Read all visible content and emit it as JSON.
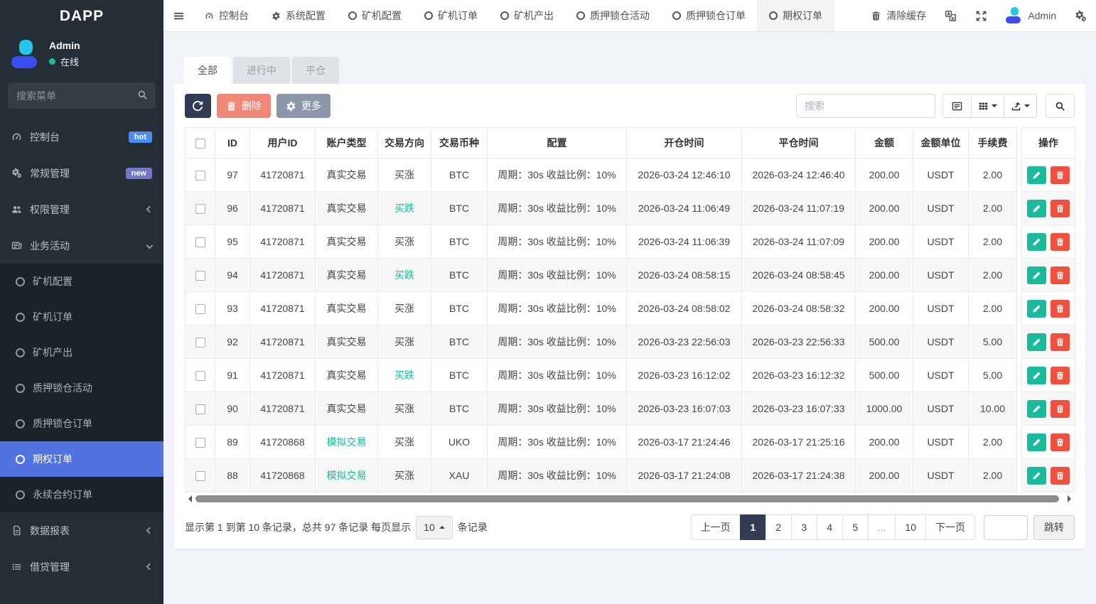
{
  "app": {
    "brand": "DAPP"
  },
  "colors": {
    "accent_green": "#18bc9c",
    "danger_red": "#f2503f",
    "navy": "#313c53",
    "active_blue": "#5172e0",
    "hot_badge": "#4a8cf5",
    "new_badge": "#7277c9"
  },
  "sidebar": {
    "user": {
      "name": "Admin",
      "status": "在线"
    },
    "search_placeholder": "搜索菜单",
    "items": [
      {
        "label": "控制台",
        "icon": "dashboard-icon",
        "badge": "hot",
        "badge_color": "#4a8cf5"
      },
      {
        "label": "常规管理",
        "icon": "gears-icon",
        "badge": "new",
        "badge_color": "#7277c9"
      },
      {
        "label": "权限管理",
        "icon": "users-icon",
        "chevron": "left"
      },
      {
        "label": "业务活动",
        "icon": "newspaper-icon",
        "chevron": "down",
        "children": [
          {
            "label": "矿机配置"
          },
          {
            "label": "矿机订单"
          },
          {
            "label": "矿机产出"
          },
          {
            "label": "质押锁仓活动"
          },
          {
            "label": "质押锁仓订单"
          },
          {
            "label": "期权订单",
            "active": true
          },
          {
            "label": "永续合约订单"
          }
        ]
      },
      {
        "label": "数据报表",
        "icon": "file-icon",
        "chevron": "left"
      },
      {
        "label": "借贷管理",
        "icon": "list-icon",
        "chevron": "left"
      }
    ]
  },
  "topbar": {
    "tabs": [
      {
        "label": "控制台",
        "icon": "dashboard-icon"
      },
      {
        "label": "系统配置",
        "icon": "gear-icon"
      },
      {
        "label": "矿机配置",
        "icon": "circle-icon"
      },
      {
        "label": "矿机订单",
        "icon": "circle-icon"
      },
      {
        "label": "矿机产出",
        "icon": "circle-icon"
      },
      {
        "label": "质押锁仓活动",
        "icon": "circle-icon"
      },
      {
        "label": "质押锁仓订单",
        "icon": "circle-icon"
      },
      {
        "label": "期权订单",
        "icon": "circle-icon",
        "active": true
      }
    ],
    "clear_cache": "清除缓存",
    "user": "Admin"
  },
  "page": {
    "tabs": [
      {
        "label": "全部",
        "active": true
      },
      {
        "label": "进行中"
      },
      {
        "label": "平仓"
      }
    ],
    "toolbar": {
      "delete_label": "删除",
      "more_label": "更多",
      "search_placeholder": "搜索"
    },
    "table": {
      "columns": [
        "ID",
        "用户ID",
        "账户类型",
        "交易方向",
        "交易币种",
        "配置",
        "开仓时间",
        "平仓时间",
        "金额",
        "金额单位",
        "手续费",
        "操作"
      ],
      "rows": [
        {
          "id": "97",
          "uid": "41720871",
          "account": "真实交易",
          "account_style": "real",
          "direction": "买涨",
          "direction_style": "up",
          "coin": "BTC",
          "config": "周期：30s 收益比例：10%",
          "open_time": "2026-03-24 12:46:10",
          "close_time": "2026-03-24 12:46:40",
          "amount": "200.00",
          "unit": "USDT",
          "fee": "2.00"
        },
        {
          "id": "96",
          "uid": "41720871",
          "account": "真实交易",
          "account_style": "real",
          "direction": "买跌",
          "direction_style": "down",
          "coin": "BTC",
          "config": "周期：30s 收益比例：10%",
          "open_time": "2026-03-24 11:06:49",
          "close_time": "2026-03-24 11:07:19",
          "amount": "200.00",
          "unit": "USDT",
          "fee": "2.00"
        },
        {
          "id": "95",
          "uid": "41720871",
          "account": "真实交易",
          "account_style": "real",
          "direction": "买涨",
          "direction_style": "up",
          "coin": "BTC",
          "config": "周期：30s 收益比例：10%",
          "open_time": "2026-03-24 11:06:39",
          "close_time": "2026-03-24 11:07:09",
          "amount": "200.00",
          "unit": "USDT",
          "fee": "2.00"
        },
        {
          "id": "94",
          "uid": "41720871",
          "account": "真实交易",
          "account_style": "real",
          "direction": "买跌",
          "direction_style": "down",
          "coin": "BTC",
          "config": "周期：30s 收益比例：10%",
          "open_time": "2026-03-24 08:58:15",
          "close_time": "2026-03-24 08:58:45",
          "amount": "200.00",
          "unit": "USDT",
          "fee": "2.00"
        },
        {
          "id": "93",
          "uid": "41720871",
          "account": "真实交易",
          "account_style": "real",
          "direction": "买涨",
          "direction_style": "up",
          "coin": "BTC",
          "config": "周期：30s 收益比例：10%",
          "open_time": "2026-03-24 08:58:02",
          "close_time": "2026-03-24 08:58:32",
          "amount": "200.00",
          "unit": "USDT",
          "fee": "2.00"
        },
        {
          "id": "92",
          "uid": "41720871",
          "account": "真实交易",
          "account_style": "real",
          "direction": "买涨",
          "direction_style": "up",
          "coin": "BTC",
          "config": "周期：30s 收益比例：10%",
          "open_time": "2026-03-23 22:56:03",
          "close_time": "2026-03-23 22:56:33",
          "amount": "500.00",
          "unit": "USDT",
          "fee": "5.00"
        },
        {
          "id": "91",
          "uid": "41720871",
          "account": "真实交易",
          "account_style": "real",
          "direction": "买跌",
          "direction_style": "down",
          "coin": "BTC",
          "config": "周期：30s 收益比例：10%",
          "open_time": "2026-03-23 16:12:02",
          "close_time": "2026-03-23 16:12:32",
          "amount": "500.00",
          "unit": "USDT",
          "fee": "5.00"
        },
        {
          "id": "90",
          "uid": "41720871",
          "account": "真实交易",
          "account_style": "real",
          "direction": "买涨",
          "direction_style": "up",
          "coin": "BTC",
          "config": "周期：30s 收益比例：10%",
          "open_time": "2026-03-23 16:07:03",
          "close_time": "2026-03-23 16:07:33",
          "amount": "1000.00",
          "unit": "USDT",
          "fee": "10.00"
        },
        {
          "id": "89",
          "uid": "41720868",
          "account": "模拟交易",
          "account_style": "sim",
          "direction": "买涨",
          "direction_style": "up",
          "coin": "UKO",
          "config": "周期：30s 收益比例：10%",
          "open_time": "2026-03-17 21:24:46",
          "close_time": "2026-03-17 21:25:16",
          "amount": "200.00",
          "unit": "USDT",
          "fee": "2.00"
        },
        {
          "id": "88",
          "uid": "41720868",
          "account": "模拟交易",
          "account_style": "sim",
          "direction": "买涨",
          "direction_style": "up",
          "coin": "XAU",
          "config": "周期：30s 收益比例：10%",
          "open_time": "2026-03-17 21:24:08",
          "close_time": "2026-03-17 21:24:38",
          "amount": "200.00",
          "unit": "USDT",
          "fee": "2.00"
        }
      ]
    },
    "pagination": {
      "summary_prefix": "显示第 1 到第 10 条记录，总共 97 条记录 每页显示",
      "page_size": "10",
      "summary_suffix": "条记录",
      "prev": "上一页",
      "pages": [
        "1",
        "2",
        "3",
        "4",
        "5",
        "...",
        "10"
      ],
      "active_page": "1",
      "next": "下一页",
      "jump": "跳转"
    }
  }
}
